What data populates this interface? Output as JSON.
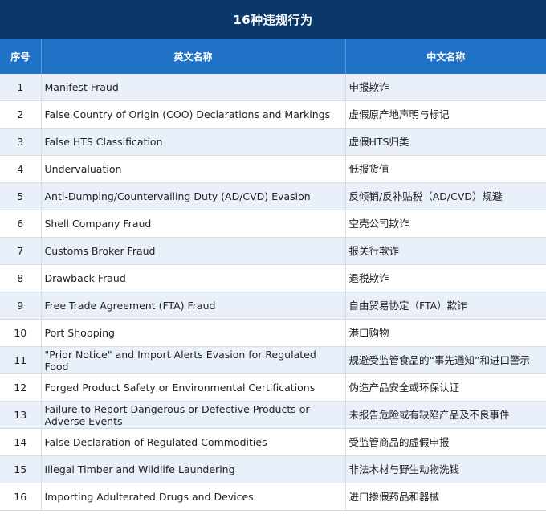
{
  "title": "16种违规行为",
  "headers": {
    "index": "序号",
    "english": "英文名称",
    "chinese": "中文名称"
  },
  "rows": [
    {
      "index": "1",
      "english": "Manifest Fraud",
      "chinese": "申报欺诈"
    },
    {
      "index": "2",
      "english": "False Country of Origin (COO) Declarations and Markings",
      "chinese": "虚假原产地声明与标记"
    },
    {
      "index": "3",
      "english": "False HTS Classification",
      "chinese": "虚假HTS归类"
    },
    {
      "index": "4",
      "english": "Undervaluation",
      "chinese": "低报货值"
    },
    {
      "index": "5",
      "english": "Anti-Dumping/Countervailing Duty (AD/CVD) Evasion",
      "chinese": "反倾销/反补贴税（AD/CVD）规避"
    },
    {
      "index": "6",
      "english": "Shell Company Fraud",
      "chinese": "空壳公司欺诈"
    },
    {
      "index": "7",
      "english": "Customs Broker Fraud",
      "chinese": "报关行欺诈"
    },
    {
      "index": "8",
      "english": "Drawback Fraud",
      "chinese": "退税欺诈"
    },
    {
      "index": "9",
      "english": "Free Trade Agreement (FTA) Fraud",
      "chinese": "自由贸易协定（FTA）欺诈"
    },
    {
      "index": "10",
      "english": "Port Shopping",
      "chinese": "港口购物"
    },
    {
      "index": "11",
      "english": "\"Prior Notice\" and Import Alerts Evasion for Regulated Food",
      "chinese": "规避受监管食品的“事先通知”和进口警示"
    },
    {
      "index": "12",
      "english": "Forged Product Safety or Environmental Certifications",
      "chinese": "伪造产品安全或环保认证"
    },
    {
      "index": "13",
      "english": "Failure to Report Dangerous or Defective Products or Adverse Events",
      "chinese": "未报告危险或有缺陷产品及不良事件"
    },
    {
      "index": "14",
      "english": "False Declaration of Regulated Commodities",
      "chinese": "受监管商品的虚假申报"
    },
    {
      "index": "15",
      "english": "Illegal Timber and Wildlife Laundering",
      "chinese": "非法木材与野生动物洗钱"
    },
    {
      "index": "16",
      "english": "Importing Adulterated Drugs and Devices",
      "chinese": "进口掺假药品和器械"
    }
  ]
}
